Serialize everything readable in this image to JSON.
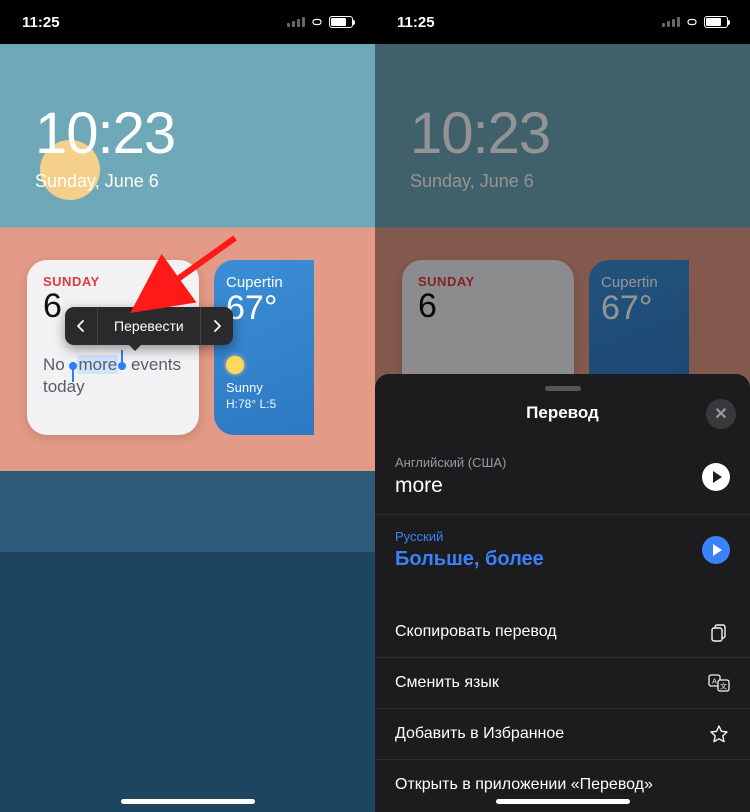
{
  "statusTime": "11:25",
  "clock": {
    "time": "10:23",
    "date": "Sunday, June 6"
  },
  "calendar": {
    "dayLabel": "SUNDAY",
    "dayNumber": "6",
    "eventsPrefix": "No",
    "selectedWord": "more",
    "eventsMid": "events",
    "eventsLine2": "today"
  },
  "weather": {
    "city": "Cupertin",
    "temp": "67°",
    "condition": "Sunny",
    "hilo": "H:78° L:5"
  },
  "contextMenu": {
    "label": "Перевести"
  },
  "sheet": {
    "title": "Перевод",
    "sourceLang": "Английский (США)",
    "sourceText": "more",
    "targetLang": "Русский",
    "targetText": "Больше, более",
    "actions": {
      "copy": "Скопировать перевод",
      "changeLang": "Сменить язык",
      "favorite": "Добавить в Избранное",
      "openApp": "Открыть в приложении «Перевод»"
    }
  }
}
